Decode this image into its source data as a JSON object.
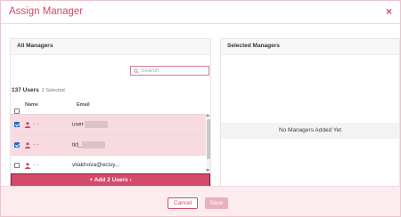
{
  "dialog": {
    "title": "Assign Manager",
    "close_icon": "×"
  },
  "left_panel": {
    "title": "All Managers",
    "search": {
      "placeholder": "Search",
      "value": ""
    },
    "count_label": "137 Users",
    "selected_label": "2 Selected",
    "columns": {
      "name": "Name",
      "email": "Email"
    },
    "rows": [
      {
        "name": "- -",
        "email": "user",
        "checked": true
      },
      {
        "name": "- -",
        "email": "tid_",
        "checked": true
      },
      {
        "name": "- -",
        "email": "vliakhova@ecisy...",
        "checked": false
      }
    ],
    "add_button": "+ Add 2 Users ›"
  },
  "right_panel": {
    "title": "Selected Managers",
    "empty_text": "No Managers Added Yet"
  },
  "footer": {
    "cancel_label": "Cancel",
    "save_label": "Save"
  },
  "colors": {
    "accent": "#d34a6a",
    "selected_row": "#f7dbe1",
    "footer_bg": "#fcecef"
  }
}
